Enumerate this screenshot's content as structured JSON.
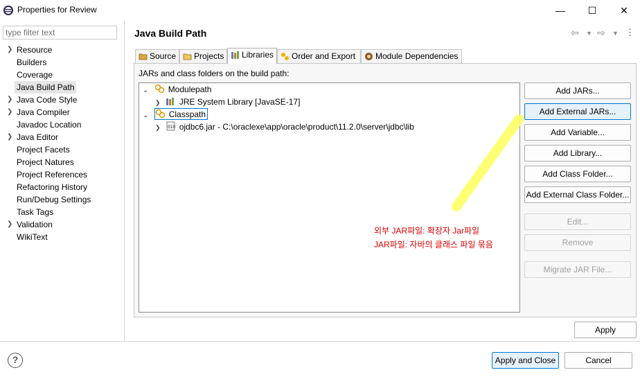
{
  "window": {
    "title": "Properties for Review",
    "minimize_glyph": "—",
    "maximize_glyph": "☐",
    "close_glyph": "✕"
  },
  "sidebar": {
    "filter_placeholder": "type filter text",
    "items": [
      {
        "label": "Resource",
        "expandable": true
      },
      {
        "label": "Builders",
        "expandable": false
      },
      {
        "label": "Coverage",
        "expandable": false
      },
      {
        "label": "Java Build Path",
        "expandable": false,
        "selected": true
      },
      {
        "label": "Java Code Style",
        "expandable": true
      },
      {
        "label": "Java Compiler",
        "expandable": true
      },
      {
        "label": "Javadoc Location",
        "expandable": false
      },
      {
        "label": "Java Editor",
        "expandable": true
      },
      {
        "label": "Project Facets",
        "expandable": false
      },
      {
        "label": "Project Natures",
        "expandable": false
      },
      {
        "label": "Project References",
        "expandable": false
      },
      {
        "label": "Refactoring History",
        "expandable": false
      },
      {
        "label": "Run/Debug Settings",
        "expandable": false
      },
      {
        "label": "Task Tags",
        "expandable": false
      },
      {
        "label": "Validation",
        "expandable": true
      },
      {
        "label": "WikiText",
        "expandable": false
      }
    ]
  },
  "page": {
    "title": "Java Build Path",
    "tabs": [
      {
        "label": "Source",
        "icon": "source-folder-icon"
      },
      {
        "label": "Projects",
        "icon": "projects-folder-icon"
      },
      {
        "label": "Libraries",
        "icon": "libraries-icon",
        "active": true
      },
      {
        "label": "Order and Export",
        "icon": "order-export-icon"
      },
      {
        "label": "Module Dependencies",
        "icon": "module-icon"
      }
    ],
    "caption": "JARs and class folders on the build path:",
    "tree": {
      "modulepath": "Modulepath",
      "jre": "JRE System Library [JavaSE-17]",
      "classpath": "Classpath",
      "jar": "ojdbc6.jar - C:\\oraclexe\\app\\oracle\\product\\11.2.0\\server\\jdbc\\lib"
    },
    "buttons": {
      "add_jars": "Add JARs...",
      "add_external_jars": "Add External JARs...",
      "add_variable": "Add Variable...",
      "add_library": "Add Library...",
      "add_class_folder": "Add Class Folder...",
      "add_external_class_folder": "Add External Class Folder...",
      "edit": "Edit...",
      "remove": "Remove",
      "migrate_jar": "Migrate JAR File..."
    },
    "annotation": {
      "line1": "외부 JAR파일: 확장자 Jar파일",
      "line2": "JAR파일: 자바의 클래스 파일 묶음",
      "color": "#e00000",
      "highlight_color": "#ffff66"
    }
  },
  "footer": {
    "apply": "Apply",
    "apply_and_close": "Apply and Close",
    "cancel": "Cancel",
    "help_glyph": "?"
  }
}
